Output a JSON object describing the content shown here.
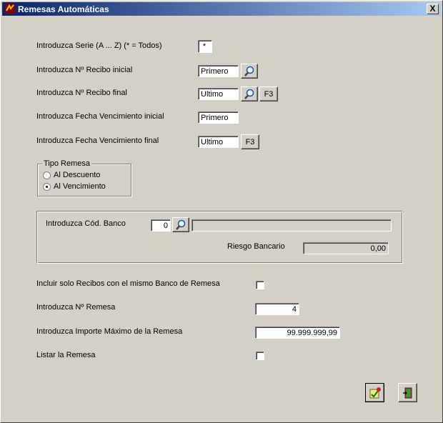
{
  "window": {
    "title": "Remesas Automáticas",
    "close_label": "X"
  },
  "form": {
    "serie_label": "Introduzca Serie (A ... Z)  (* = Todos)",
    "serie_value": "*",
    "recibo_inicial_label": "Introduzca Nº Recibo inicial",
    "recibo_inicial_value": "Primero",
    "recibo_final_label": "Introduzca Nº Recibo final",
    "recibo_final_value": "Ultimo",
    "fecha_inicial_label": "Introduzca Fecha Vencimiento inicial",
    "fecha_inicial_value": "Primero",
    "fecha_final_label": "Introduzca Fecha Vencimiento final",
    "fecha_final_value": "Ultimo",
    "f3_label": "F3",
    "tipo_remesa": {
      "title": "Tipo Remesa",
      "options": [
        "Al Descuento",
        "Al Vencimiento"
      ],
      "selected": "Al Vencimiento"
    },
    "banco_label": "Introduzca Cód. Banco",
    "banco_value": "0",
    "banco_name": "",
    "riesgo_label": "Riesgo Bancario",
    "riesgo_value": "0,00",
    "solo_mismo_banco_label": "Incluir solo Recibos con el mismo Banco de Remesa",
    "solo_mismo_banco_checked": false,
    "num_remesa_label": "Introduzca Nº Remesa",
    "num_remesa_value": "4",
    "importe_max_label": "Introduzca Importe Máximo de la Remesa",
    "importe_max_value": "99.999.999,99",
    "listar_label": "Listar la Remesa",
    "listar_checked": false
  },
  "icons": {
    "search": "magnifier-icon",
    "accept": "execute-icon",
    "exit": "exit-door-icon"
  }
}
